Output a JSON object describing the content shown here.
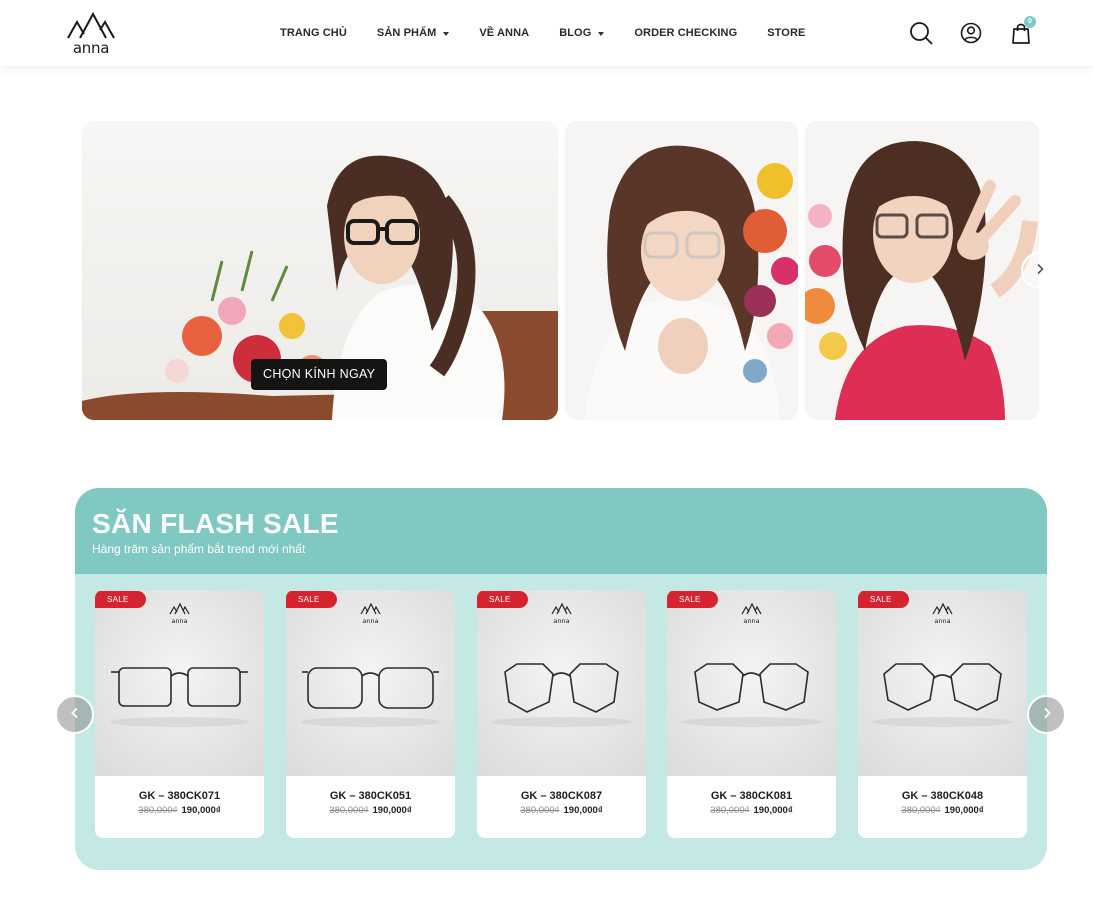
{
  "brand": {
    "logo_text": "anna"
  },
  "nav": {
    "items": [
      {
        "label": "TRANG CHỦ",
        "dropdown": false
      },
      {
        "label": "SẢN PHẨM",
        "dropdown": true
      },
      {
        "label": "VỀ ANNA",
        "dropdown": false
      },
      {
        "label": "BLOG",
        "dropdown": true
      },
      {
        "label": "ORDER CHECKING",
        "dropdown": false
      },
      {
        "label": "STORE",
        "dropdown": false
      }
    ]
  },
  "header_icons": {
    "search": "search-icon",
    "account": "user-icon",
    "cart": "shopping-bag-icon",
    "cart_count": "0"
  },
  "hero": {
    "cta_label": "CHỌN KÍNH NGAY",
    "next_icon": "chevron-right-icon"
  },
  "flash_sale": {
    "title": "SĂN FLASH SALE",
    "subtitle": "Hàng trăm sản phẩm bắt trend mới nhất",
    "sale_badge": "SALE",
    "products": [
      {
        "name": "GK – 380CK071",
        "old_price": "380,000₫",
        "new_price": "190,000₫"
      },
      {
        "name": "GK – 380CK051",
        "old_price": "380,000₫",
        "new_price": "190,000₫"
      },
      {
        "name": "GK – 380CK087",
        "old_price": "380,000₫",
        "new_price": "190,000₫"
      },
      {
        "name": "GK – 380CK081",
        "old_price": "380,000₫",
        "new_price": "190,000₫"
      },
      {
        "name": "GK – 380CK048",
        "old_price": "380,000₫",
        "new_price": "190,000₫"
      }
    ]
  },
  "colors": {
    "accent_teal": "#80c9c2",
    "light_teal": "#c4e9e5",
    "sale_red": "#d62330",
    "cta_black": "#141414"
  }
}
